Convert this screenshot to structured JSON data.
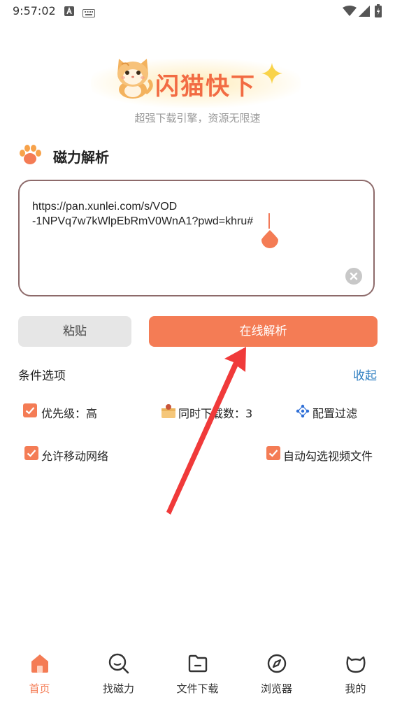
{
  "status_bar": {
    "time": "9:57:02",
    "icons": [
      "notification-a-icon",
      "keyboard-icon",
      "wifi-icon",
      "signal-icon",
      "battery-icon"
    ]
  },
  "brand": {
    "title": "闪猫快下",
    "subtitle": "超强下载引擎，资源无限速",
    "title_color": "#f26b43"
  },
  "section": {
    "title": "磁力解析",
    "icon": "paw-icon"
  },
  "url_input": {
    "value": "https://pan.xunlei.com/s/VOD\n-1NPVq7w7kWlpEbRmV0WnA1?pwd=khru#"
  },
  "buttons": {
    "paste_label": "粘贴",
    "parse_label": "在线解析",
    "accent_color": "#f47c55"
  },
  "options": {
    "title": "条件选项",
    "collapse_label": "收起",
    "priority_label": "优先级：高",
    "concurrent_label": "同时下载数：3",
    "filter_label": "配置过滤",
    "mobile_network_label": "允许移动网络",
    "auto_select_video_label": "自动勾选视频文件"
  },
  "nav": {
    "items": [
      {
        "label": "首页",
        "icon": "home-icon",
        "active": true
      },
      {
        "label": "找磁力",
        "icon": "search-icon",
        "active": false
      },
      {
        "label": "文件下载",
        "icon": "folder-icon",
        "active": false
      },
      {
        "label": "浏览器",
        "icon": "compass-icon",
        "active": false
      },
      {
        "label": "我的",
        "icon": "cat-face-icon",
        "active": false
      }
    ]
  }
}
